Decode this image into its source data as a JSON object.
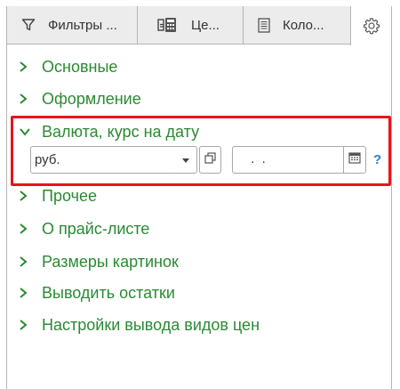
{
  "tabs": [
    {
      "label": "Фильтры ...",
      "icon": "funnel-icon"
    },
    {
      "label": "Це...",
      "icon": "price-table-icon"
    },
    {
      "label": "Коло...",
      "icon": "columns-list-icon"
    },
    {
      "label": "",
      "icon": "gear-icon",
      "active": true
    }
  ],
  "sections": [
    {
      "label": "Основные",
      "expanded": false
    },
    {
      "label": "Оформление",
      "expanded": false
    },
    {
      "label": "Валюта, курс на дату",
      "expanded": true
    },
    {
      "label": "Прочее",
      "expanded": false
    },
    {
      "label": "О прайс-листе",
      "expanded": false
    },
    {
      "label": "Размеры картинок",
      "expanded": false
    },
    {
      "label": "Выводить остатки",
      "expanded": false
    },
    {
      "label": "Настройки вывода видов цен",
      "expanded": false
    }
  ],
  "currency": {
    "value": "руб.",
    "date_value": " .  ."
  },
  "help_label": "?",
  "colors": {
    "accent_green": "#2a8a32",
    "highlight_red": "#e8141c",
    "help_blue": "#2c7fc4"
  }
}
